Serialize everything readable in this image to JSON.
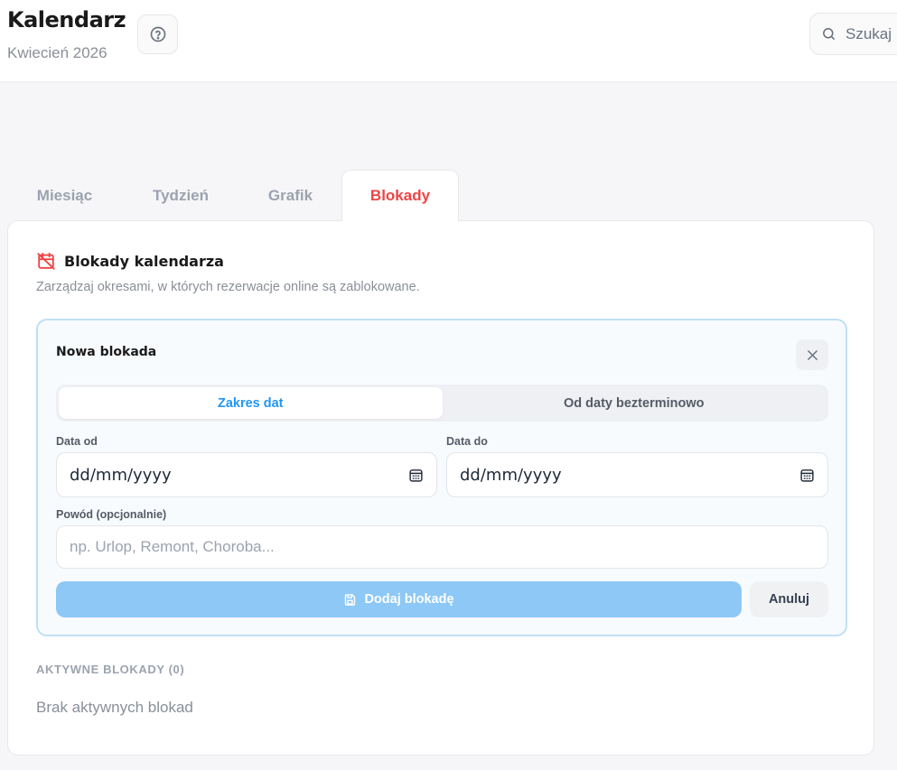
{
  "header": {
    "title": "Kalendarz",
    "subtitle": "Kwiecień 2026",
    "search_placeholder": "Szukaj"
  },
  "tabs": [
    {
      "label": "Miesiąc",
      "active": false
    },
    {
      "label": "Tydzień",
      "active": false
    },
    {
      "label": "Grafik",
      "active": false
    },
    {
      "label": "Blokady",
      "active": true
    }
  ],
  "panel": {
    "title": "Blokady kalendarza",
    "description": "Zarządzaj okresami, w których rezerwacje online są zablokowane.",
    "form": {
      "title": "Nowa blokada",
      "mode_options": [
        "Zakres dat",
        "Od daty bezterminowo"
      ],
      "selected_mode": "Zakres dat",
      "date_from_label": "Data od",
      "date_from_value": "dd/mm/yyyy",
      "date_to_label": "Data do",
      "date_to_value": "dd/mm/yyyy",
      "reason_label": "Powód (opcjonalnie)",
      "reason_placeholder": "np. Urlop, Remont, Choroba...",
      "submit_label": "Dodaj blokadę",
      "cancel_label": "Anuluj"
    },
    "active_section_label": "AKTYWNE BLOKADY (0)",
    "empty_text": "Brak aktywnych blokad"
  },
  "colors": {
    "accent_red": "#ef4444",
    "accent_blue": "#2196f3",
    "submit_disabled": "#8dc8f6",
    "form_border": "#bfe0f5"
  }
}
